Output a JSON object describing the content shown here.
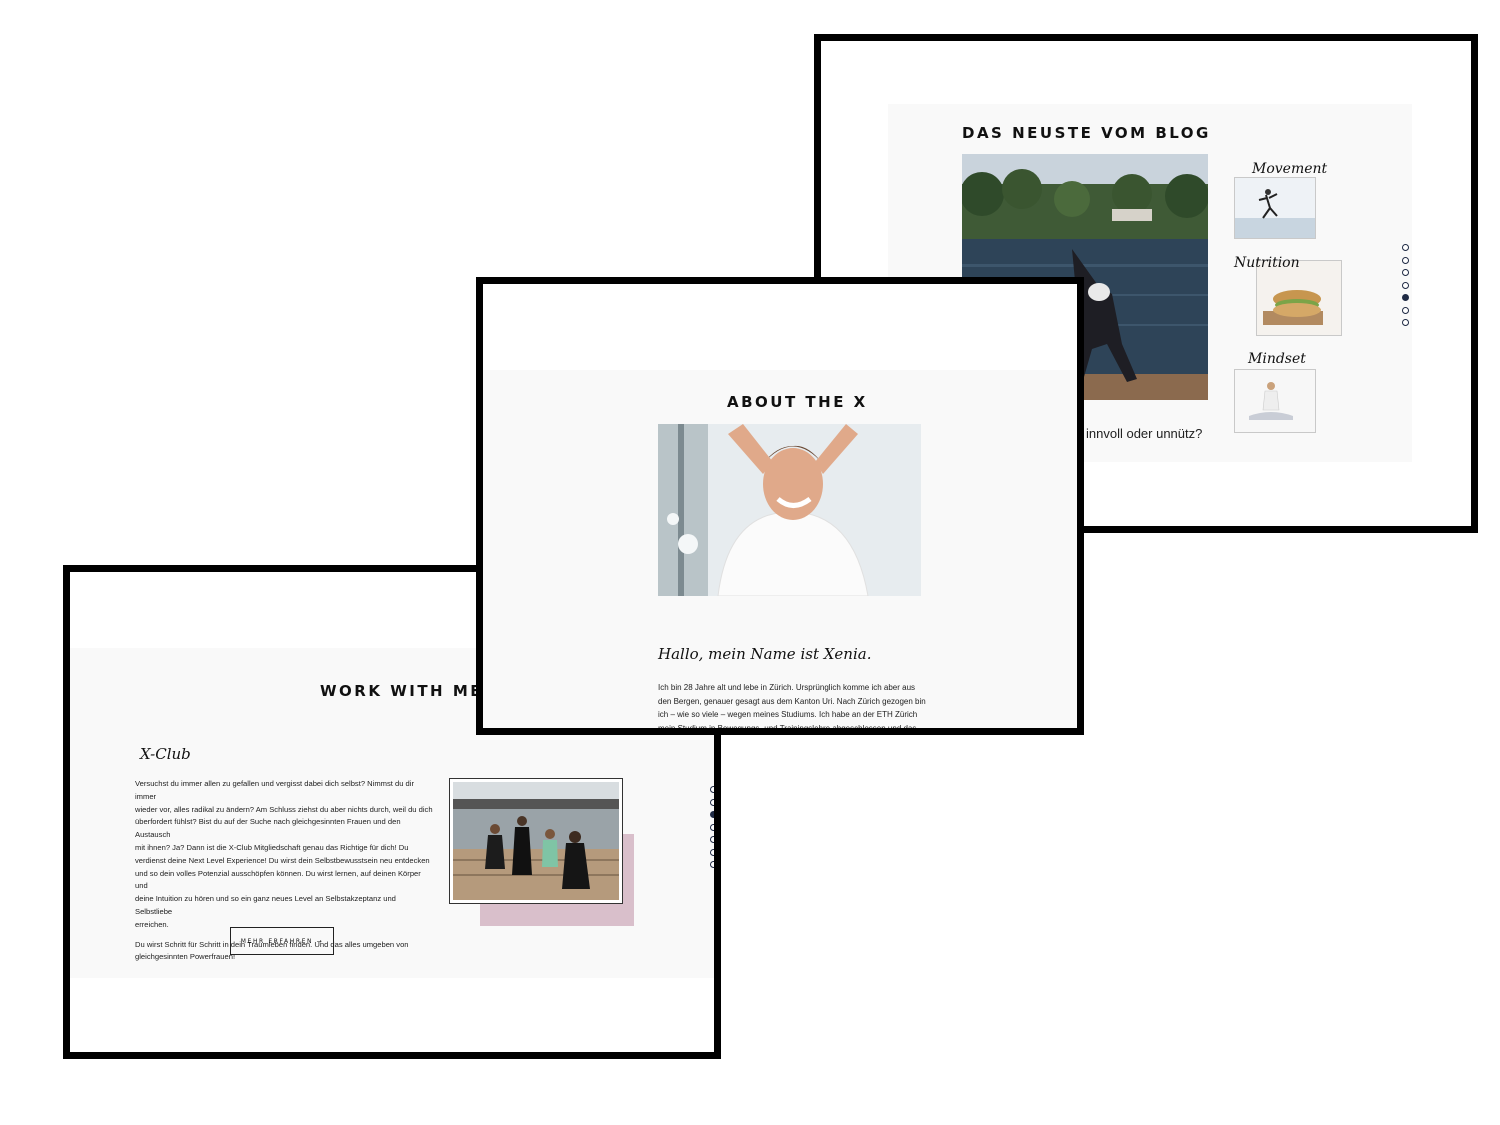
{
  "blog": {
    "title": "DAS NEUSTE VOM BLOG",
    "partial_text": "innvoll oder unnütz?",
    "thumbnails": [
      {
        "label": "Movement"
      },
      {
        "label": "Nutrition"
      },
      {
        "label": "Mindset"
      }
    ],
    "active_dot": 5
  },
  "about": {
    "title": "ABOUT THE X",
    "greeting": "Hallo, mein Name ist Xenia.",
    "paragraph_lines": [
      "Ich bin 28 Jahre alt und lebe in Zürich. Ursprünglich komme ich aber aus",
      "den Bergen, genauer gesagt aus dem Kanton Uri. Nach Zürich gezogen bin",
      "ich – wie so viele – wegen meines Studiums. Ich habe an der ETH Zürich",
      "mein Studium in Bewegungs- und Trainingslehre abgeschlossen und das"
    ]
  },
  "work": {
    "title": "WORK WITH ME",
    "subtitle": "X-Club",
    "paragraph1_lines": [
      "Versuchst du immer allen zu gefallen und vergisst dabei dich selbst? Nimmst du dir immer",
      "wieder vor, alles radikal zu ändern? Am Schluss ziehst du aber nichts durch, weil du dich",
      "überfordert fühlst? Bist du auf der Suche nach gleichgesinnten Frauen und den Austausch",
      "mit ihnen? Ja? Dann ist die X-Club Mitgliedschaft genau das Richtige für dich! Du",
      "verdienst deine Next Level Experience! Du wirst dein Selbstbewusstsein neu entdecken",
      "und so dein volles Potenzial ausschöpfen können. Du wirst lernen, auf deinen Körper und",
      "deine Intuition zu hören und so ein ganz neues Level an Selbstakzeptanz und Selbstliebe",
      "erreichen."
    ],
    "paragraph2_lines": [
      "Du wirst Schritt für Schritt in dein Traumleben finden. Und das alles umgeben von",
      "gleichgesinnten Powerfrauen!"
    ],
    "button_label": "MEHR ERFAHREN →",
    "active_dot": 3
  },
  "colors": {
    "frame": "#000000",
    "panel": "#f9f9f9",
    "dot": "#1f2a44",
    "accent_pink": "#d9bfcb"
  }
}
